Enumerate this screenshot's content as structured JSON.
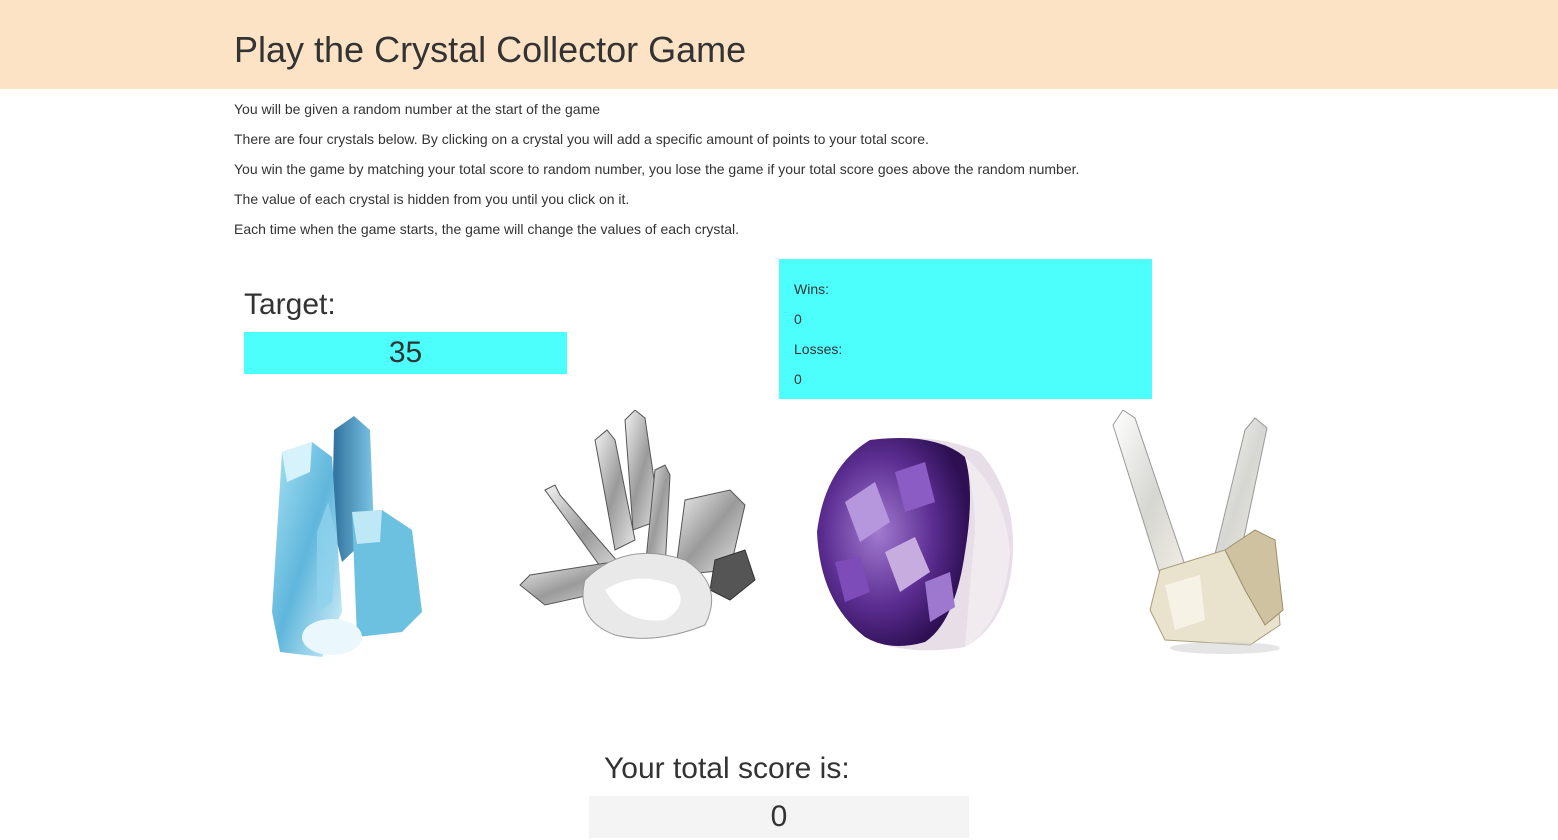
{
  "header": {
    "title": "Play the Crystal Collector Game"
  },
  "instructions": [
    "You will be given a random number at the start of the game",
    "There are four crystals below. By clicking on a crystal you will add a specific amount of points to your total score.",
    "You win the game by matching your total score to random number, you lose the game if your total score goes above the random number.",
    "The value of each crystal is hidden from you until you click on it.",
    "Each time when the game starts, the game will change the values of each crystal."
  ],
  "target": {
    "label": "Target:",
    "value": "35"
  },
  "stats": {
    "wins_label": "Wins:",
    "wins_value": "0",
    "losses_label": "Losses:",
    "losses_value": "0"
  },
  "crystals": [
    {
      "name": "aqua-aura-crystal",
      "color": "#7fc9e6"
    },
    {
      "name": "clear-quartz-cluster",
      "color": "#b8b8b8"
    },
    {
      "name": "amethyst-geode",
      "color": "#6a3aa0"
    },
    {
      "name": "quartz-points",
      "color": "#e8e4d6"
    }
  ],
  "score": {
    "label": "Your total score is:",
    "value": "0"
  },
  "colors": {
    "header_bg": "#fce3c6",
    "accent_cyan": "#4cfffd",
    "score_bg": "#f4f4f4"
  }
}
